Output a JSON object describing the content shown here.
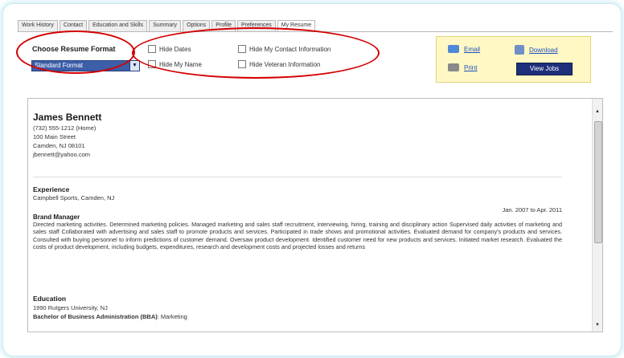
{
  "tabs": [
    {
      "label": "Work History"
    },
    {
      "label": "Contact"
    },
    {
      "label": "Education and Skills"
    },
    {
      "label": "Summary"
    },
    {
      "label": "Options"
    },
    {
      "label": "Profile"
    },
    {
      "label": "Preferences"
    },
    {
      "label": "My Resume",
      "active": true
    }
  ],
  "format": {
    "title": "Choose Resume Format",
    "selected": "Standard Format"
  },
  "options": {
    "hide_dates": "Hide Dates",
    "hide_name": "Hide My Name",
    "hide_contact": "Hide My Contact Information",
    "hide_veteran": "Hide Veteran Information"
  },
  "actions": {
    "email": "Email",
    "download": "Download",
    "print": "Print",
    "view_jobs": "View Jobs"
  },
  "resume": {
    "name": "James Bennett",
    "phone": "(732) 555-1212 (Home)",
    "street": "100 Main Street",
    "city": "Camden, NJ 08101",
    "email": "jbennett@yahoo.com",
    "experience_heading": "Experience",
    "employer": "Campbell Sports, Camden, NJ",
    "dates": "Jan. 2007 to Apr. 2011",
    "job_title": "Brand Manager",
    "job_description": "Directed marketing activities. Determined marketing policies. Managed marketing and sales staff recruitment, interviewing, hiring, training and disciplinary action Supervised daily activities of marketing and sales staff Collaborated with advertising and sales staff to promote products and services. Participated in trade shows and promotional activities. Evaluated demand for company's products and services. Consulted with buying personnel to inform predictions of customer demand. Oversaw product development. Identified customer need for new products and services. Initiated market research. Evaluated the costs of product development, including budgets, expenditures, research and development costs and projected losses and returns",
    "education_heading": "Education",
    "school": "1990 Rutgers University, NJ",
    "degree": "Bachelor of Business Administration (BBA)",
    "major": ": Marketing"
  },
  "colors": {
    "annotation": "#d40000",
    "select_bg": "#3d5ea8",
    "action_box_bg": "#fff8c4",
    "view_jobs_bg": "#1d2f7a"
  }
}
